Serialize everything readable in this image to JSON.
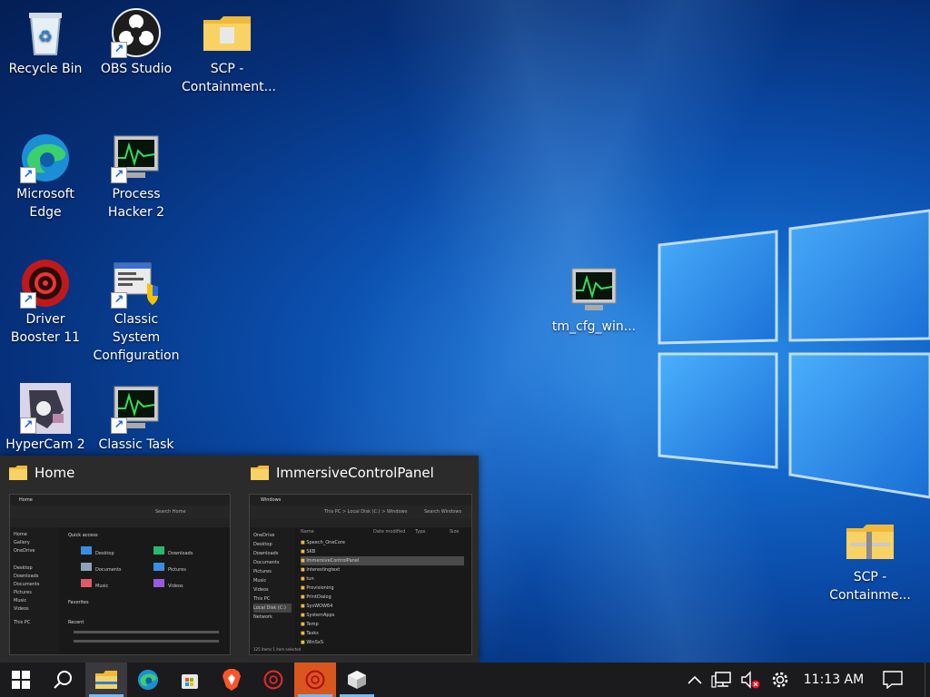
{
  "desktop": {
    "icons": [
      {
        "label": "Recycle Bin"
      },
      {
        "label": "OBS Studio"
      },
      {
        "label": "SCP - Containment..."
      },
      {
        "label": "Microsoft Edge"
      },
      {
        "label": "Process Hacker 2"
      },
      {
        "label": "Driver Booster 11"
      },
      {
        "label": "Classic System Configuration"
      },
      {
        "label": "HyperCam 2"
      },
      {
        "label": "Classic Task Manager"
      },
      {
        "label": "tm_cfg_win..."
      },
      {
        "label": "SCP - Containme..."
      }
    ]
  },
  "preview": {
    "windows": [
      {
        "title": "Home"
      },
      {
        "title": "ImmersiveControlPanel"
      }
    ],
    "home_thumb": {
      "header": "Home",
      "search": "Search Home",
      "section_quick": "Quick access",
      "section_fav": "Favorites",
      "section_recent": "Recent",
      "quick_items": [
        "Desktop",
        "Downloads",
        "Documents",
        "Pictures",
        "Music",
        "Videos"
      ],
      "nav": [
        "Home",
        "Gallery",
        "OneDrive",
        "Desktop",
        "Downloads",
        "Documents",
        "Pictures",
        "Music",
        "Videos",
        "This PC"
      ]
    },
    "cp_thumb": {
      "header": "Windows",
      "path": "This PC > Local Disk (C:) > Windows",
      "search": "Search Windows",
      "columns": [
        "Name",
        "Date modified",
        "Type",
        "Size"
      ],
      "rows": [
        "Speech_OneCore",
        "SKB",
        "ImmersiveControlPanel",
        "Interestingtext",
        "tun",
        "Provisioning",
        "PrintDialog",
        "SysWOW64",
        "SystemApps",
        "Temp",
        "Tasks",
        "WinSxS"
      ],
      "nav": [
        "OneDrive",
        "Desktop",
        "Downloads",
        "Documents",
        "Pictures",
        "Music",
        "Videos",
        "This PC",
        "Local Disk (C:)",
        "Network"
      ],
      "status": "125 items  1 item selected"
    }
  },
  "taskbar": {
    "clock": "11:13 AM"
  },
  "colors": {
    "taskbar": "#1b1b1d",
    "accent": "#76b9ed",
    "folder": "#f4c542"
  }
}
